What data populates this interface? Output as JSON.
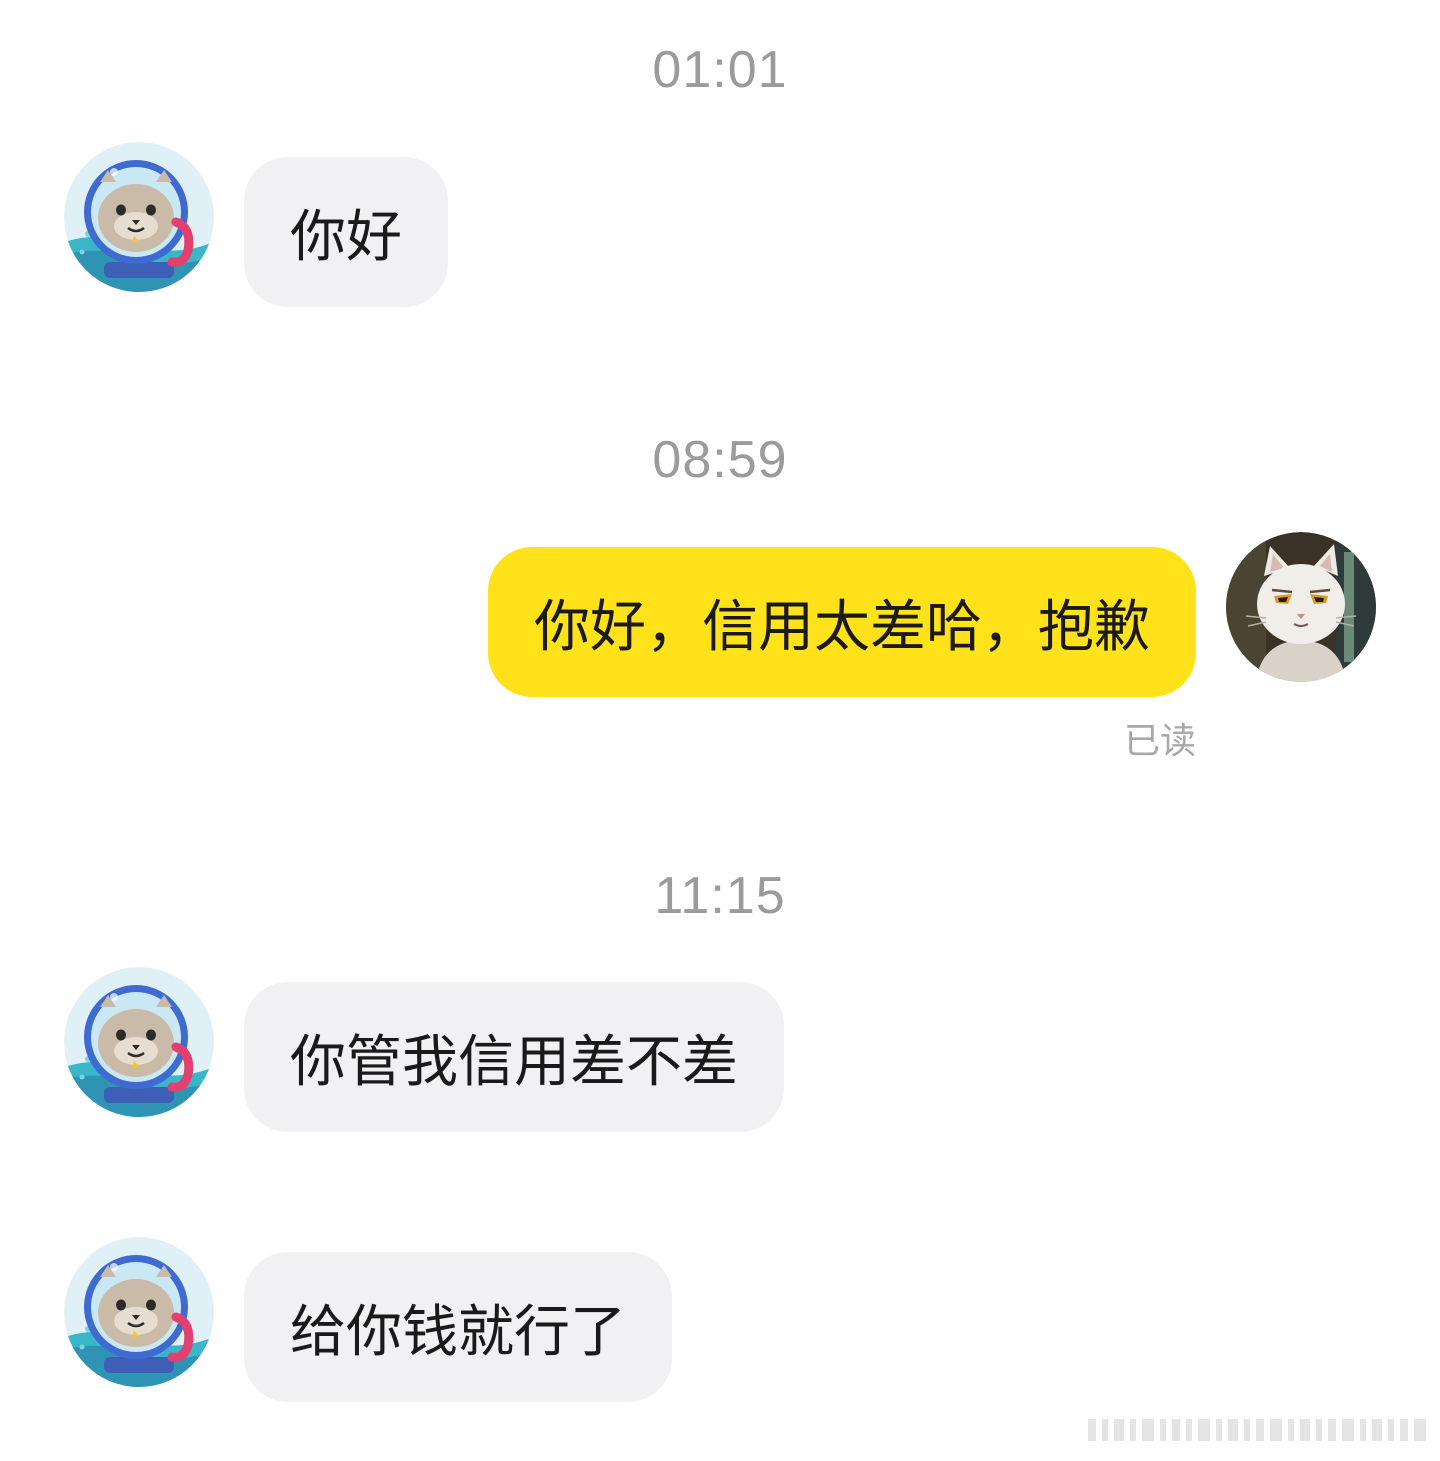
{
  "messages": [
    {
      "type": "timestamp",
      "text": "01:01"
    },
    {
      "type": "incoming",
      "text": "你好",
      "avatar": "seal-astronaut-icon"
    },
    {
      "type": "timestamp",
      "text": "08:59"
    },
    {
      "type": "outgoing",
      "text": "你好，信用太差哈，抱歉",
      "avatar": "white-cat-icon",
      "status": "已读"
    },
    {
      "type": "timestamp",
      "text": "11:15"
    },
    {
      "type": "incoming",
      "text": "你管我信用差不差",
      "avatar": "seal-astronaut-icon"
    },
    {
      "type": "incoming",
      "text": "给你钱就行了",
      "avatar": "seal-astronaut-icon"
    }
  ],
  "colors": {
    "outgoing_bubble": "#ffe21a",
    "incoming_bubble": "#f1f1f3",
    "timestamp_text": "#9b9b9b",
    "status_text": "#a8a8a8"
  }
}
